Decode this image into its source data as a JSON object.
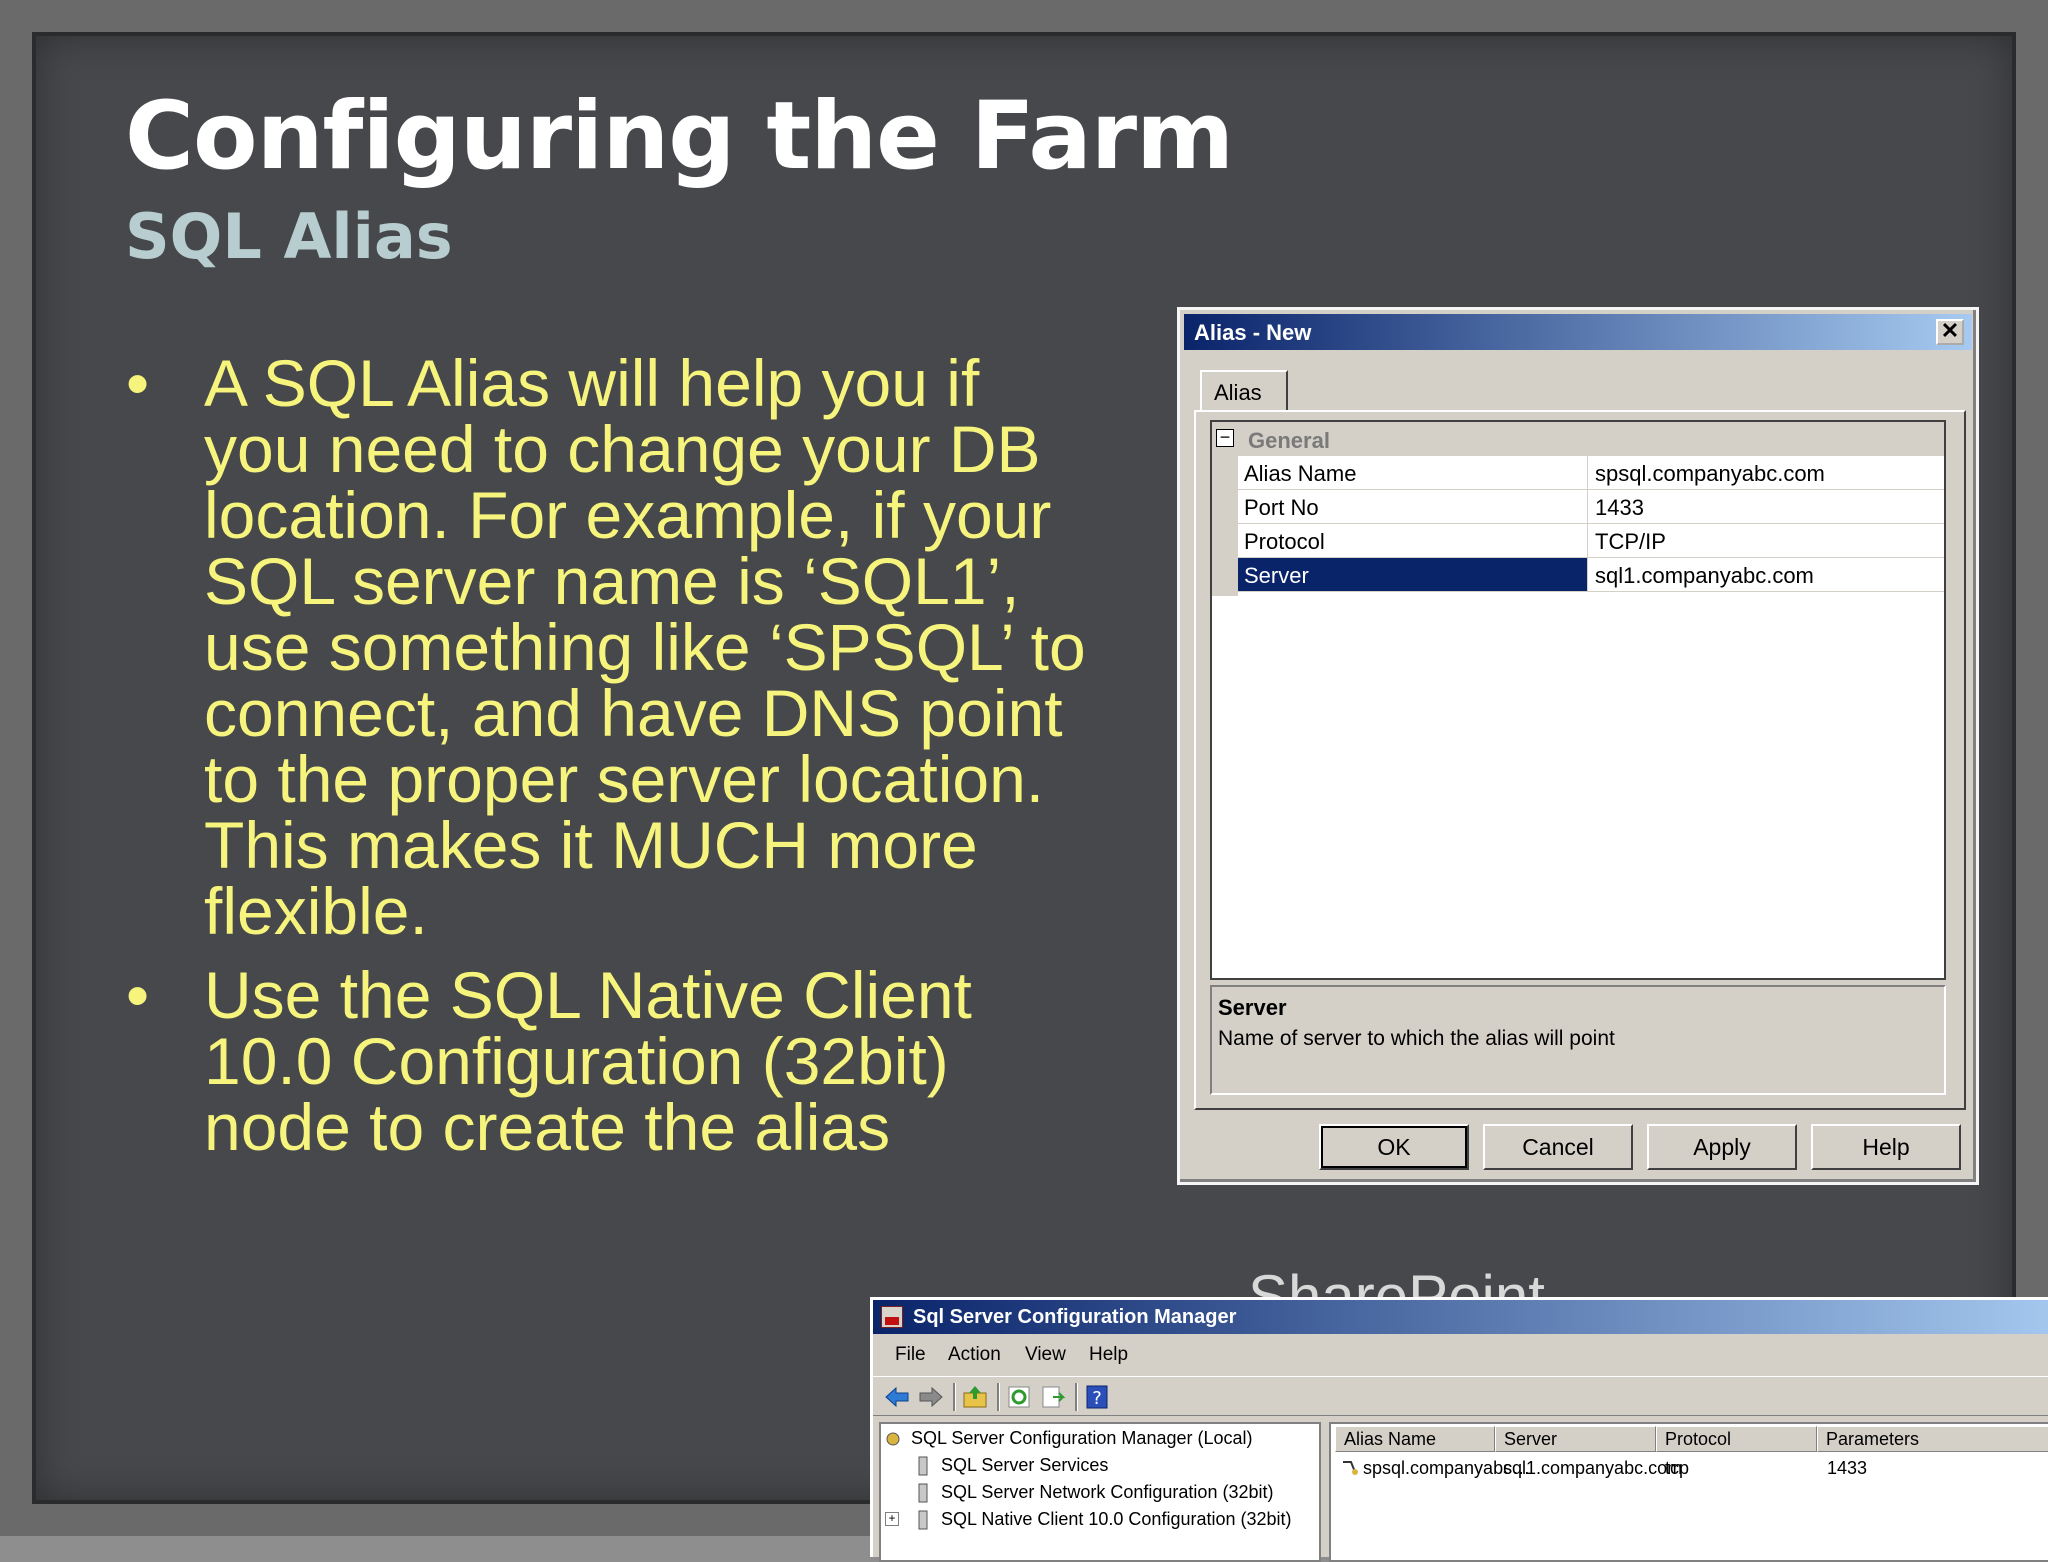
{
  "slide": {
    "title": "Configuring the Farm",
    "subtitle": "SQL Alias",
    "bullets": [
      "A SQL Alias will help you if you need to change your DB location.  For example, if your SQL server name is ‘SQL1’, use something like ‘SPSQL’ to connect, and have DNS point to the proper server location.  This makes it MUCH more flexible.",
      "Use the SQL Native Client 10.0 Configuration (32bit) node to create the alias"
    ],
    "bullet_marker": "•",
    "ghost_text": "SharePoint"
  },
  "dialog": {
    "title": "Alias - New",
    "close_glyph": "✕",
    "tab_label": "Alias",
    "category": "General",
    "category_toggle": "−",
    "properties": [
      {
        "name": "Alias Name",
        "value": "spsql.companyabc.com"
      },
      {
        "name": "Port No",
        "value": "1433"
      },
      {
        "name": "Protocol",
        "value": "TCP/IP"
      },
      {
        "name": "Server",
        "value": "sql1.companyabc.com"
      }
    ],
    "description_title": "Server",
    "description_text": "Name of server to which the alias will point",
    "buttons": {
      "ok": "OK",
      "cancel": "Cancel",
      "apply": "Apply",
      "help": "Help"
    }
  },
  "mmc": {
    "title": "Sql Server Configuration Manager",
    "menu": {
      "file": "File",
      "action": "Action",
      "view": "View",
      "help": "Help"
    },
    "tree": {
      "root": "SQL Server Configuration Manager (Local)",
      "services": "SQL Server Services",
      "network": "SQL Server Network Configuration (32bit)",
      "native_client": "SQL Native Client 10.0 Configuration (32bit)",
      "expand_glyph": "+"
    },
    "list": {
      "columns": [
        "Alias Name",
        "Server",
        "Protocol",
        "Parameters"
      ],
      "row": {
        "alias": "spsql.companyabc…",
        "server": "sql1.companyabc.com",
        "protocol": "tcp",
        "parameters": "1433"
      }
    }
  },
  "colors": {
    "slide_bg": "#46484b",
    "title": "#ffffff",
    "subtitle": "#b7cdd0",
    "bullet_text": "#f6f47c",
    "titlebar_start": "#0a246a",
    "titlebar_end": "#a6caf0",
    "selection": "#0a246a"
  },
  "icons": {
    "back": "back-arrow-icon",
    "forward": "forward-arrow-icon",
    "up": "up-folder-icon",
    "refresh": "refresh-icon",
    "export": "export-list-icon",
    "help": "help-icon"
  }
}
